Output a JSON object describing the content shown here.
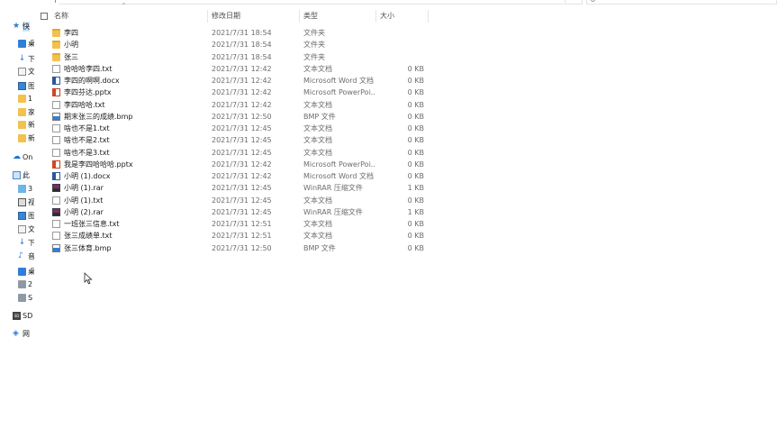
{
  "header": {
    "name": "名称",
    "date": "修改日期",
    "type": "类型",
    "size": "大小"
  },
  "nav": {
    "items": [
      {
        "label": "快",
        "icon": "pin-icon"
      },
      {
        "label": "桌",
        "icon": "desktop-icon"
      },
      {
        "label": "下",
        "icon": "download-icon"
      },
      {
        "label": "文",
        "icon": "document-icon"
      },
      {
        "label": "图",
        "icon": "picture-icon"
      },
      {
        "label": "1",
        "icon": "folder-icon"
      },
      {
        "label": "家",
        "icon": "folder-icon"
      },
      {
        "label": "新",
        "icon": "folder-icon"
      },
      {
        "label": "新",
        "icon": "folder-icon"
      },
      {
        "label": "On",
        "icon": "cloud-icon"
      },
      {
        "label": "此",
        "icon": "this-pc-icon"
      },
      {
        "label": "3",
        "icon": "3d-objects-icon"
      },
      {
        "label": "视",
        "icon": "video-icon"
      },
      {
        "label": "图",
        "icon": "picture-icon"
      },
      {
        "label": "文",
        "icon": "document-icon"
      },
      {
        "label": "下",
        "icon": "download-icon"
      },
      {
        "label": "音",
        "icon": "music-icon"
      },
      {
        "label": "桌",
        "icon": "desktop-icon"
      },
      {
        "label": "2",
        "icon": "drive-icon"
      },
      {
        "label": "S",
        "icon": "drive-icon"
      },
      {
        "label": "SD",
        "icon": "sd-card-icon"
      },
      {
        "label": "网",
        "icon": "network-icon"
      }
    ]
  },
  "files": [
    {
      "name": "李四",
      "date": "2021/7/31 18:54",
      "type": "文件夹",
      "size": "",
      "icon": "folder-icon"
    },
    {
      "name": "小明",
      "date": "2021/7/31 18:54",
      "type": "文件夹",
      "size": "",
      "icon": "folder-icon"
    },
    {
      "name": "张三",
      "date": "2021/7/31 18:54",
      "type": "文件夹",
      "size": "",
      "icon": "folder-icon"
    },
    {
      "name": "哈哈哈李四.txt",
      "date": "2021/7/31 12:42",
      "type": "文本文档",
      "size": "0 KB",
      "icon": "txt-file-icon"
    },
    {
      "name": "李四的啊啊.docx",
      "date": "2021/7/31 12:42",
      "type": "Microsoft Word 文档",
      "size": "0 KB",
      "icon": "word-file-icon"
    },
    {
      "name": "李四芬达.pptx",
      "date": "2021/7/31 12:42",
      "type": "Microsoft PowerPoi...",
      "size": "0 KB",
      "icon": "powerpoint-file-icon"
    },
    {
      "name": "李四哈哈.txt",
      "date": "2021/7/31 12:42",
      "type": "文本文档",
      "size": "0 KB",
      "icon": "txt-file-icon"
    },
    {
      "name": "期末张三的成绩.bmp",
      "date": "2021/7/31 12:50",
      "type": "BMP 文件",
      "size": "0 KB",
      "icon": "bmp-file-icon"
    },
    {
      "name": "啥也不是1.txt",
      "date": "2021/7/31 12:45",
      "type": "文本文档",
      "size": "0 KB",
      "icon": "txt-file-icon"
    },
    {
      "name": "啥也不是2.txt",
      "date": "2021/7/31 12:45",
      "type": "文本文档",
      "size": "0 KB",
      "icon": "txt-file-icon"
    },
    {
      "name": "啥也不是3.txt",
      "date": "2021/7/31 12:45",
      "type": "文本文档",
      "size": "0 KB",
      "icon": "txt-file-icon"
    },
    {
      "name": "我是李四哈哈哈.pptx",
      "date": "2021/7/31 12:42",
      "type": "Microsoft PowerPoi...",
      "size": "0 KB",
      "icon": "powerpoint-file-icon"
    },
    {
      "name": "小明 (1).docx",
      "date": "2021/7/31 12:42",
      "type": "Microsoft Word 文档",
      "size": "0 KB",
      "icon": "word-file-icon"
    },
    {
      "name": "小明 (1).rar",
      "date": "2021/7/31 12:45",
      "type": "WinRAR 压缩文件",
      "size": "1 KB",
      "icon": "rar-file-icon"
    },
    {
      "name": "小明 (1).txt",
      "date": "2021/7/31 12:45",
      "type": "文本文档",
      "size": "0 KB",
      "icon": "txt-file-icon"
    },
    {
      "name": "小明 (2).rar",
      "date": "2021/7/31 12:45",
      "type": "WinRAR 压缩文件",
      "size": "1 KB",
      "icon": "rar-file-icon"
    },
    {
      "name": "一班张三信息.txt",
      "date": "2021/7/31 12:51",
      "type": "文本文档",
      "size": "0 KB",
      "icon": "txt-file-icon"
    },
    {
      "name": "张三成绩单.txt",
      "date": "2021/7/31 12:51",
      "type": "文本文档",
      "size": "0 KB",
      "icon": "txt-file-icon"
    },
    {
      "name": "张三体育.bmp",
      "date": "2021/7/31 12:50",
      "type": "BMP 文件",
      "size": "0 KB",
      "icon": "bmp-file-icon"
    }
  ]
}
